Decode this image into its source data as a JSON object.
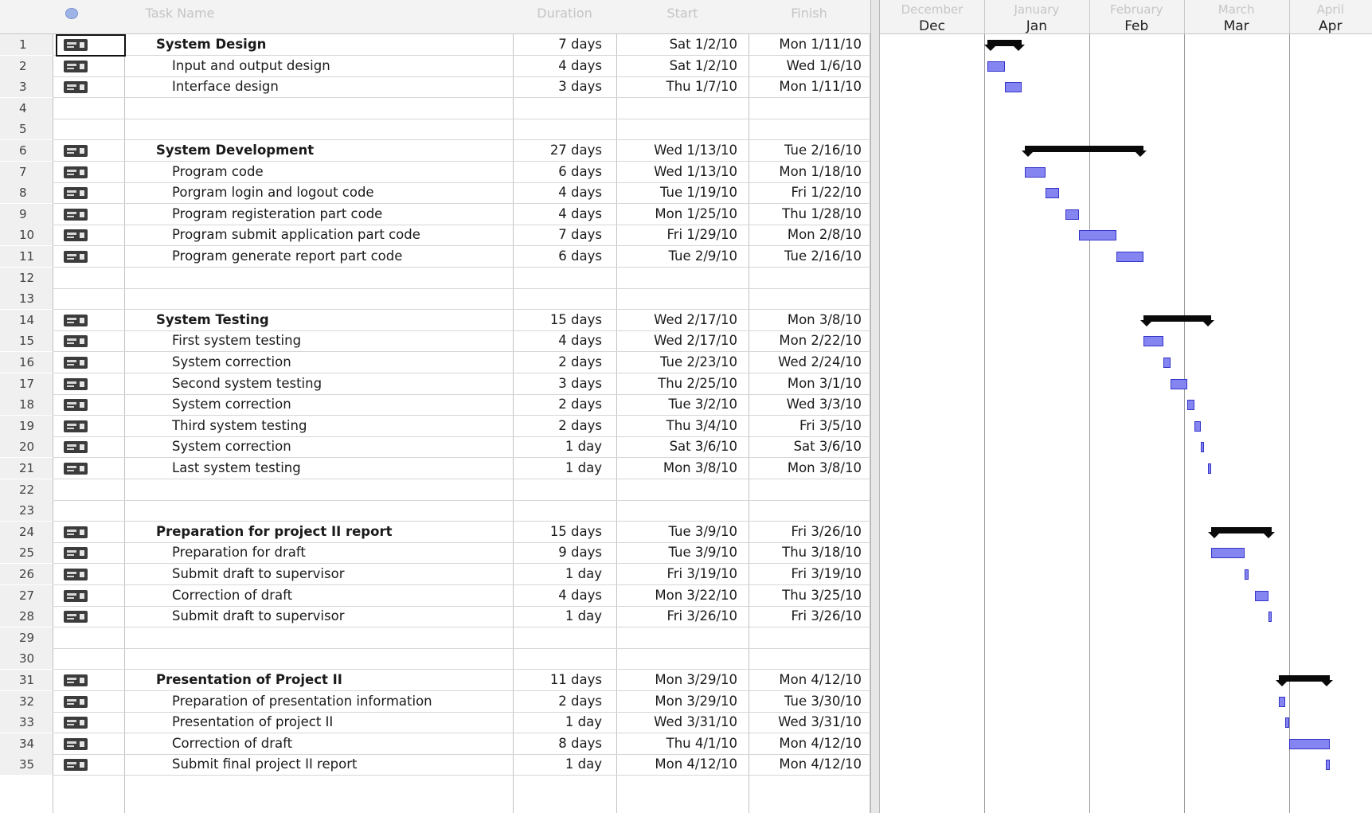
{
  "header": {
    "indicator_icon": "circle-info-icon",
    "columns": {
      "name": "Task Name",
      "duration": "Duration",
      "start": "Start",
      "finish": "Finish"
    },
    "timescale_top": [
      "December",
      "January",
      "February",
      "March",
      "April"
    ],
    "timescale_bottom": [
      "Dec",
      "Jan",
      "Feb",
      "Mar",
      "Apr"
    ]
  },
  "tasks": [
    {
      "id": "1",
      "name": "System Design",
      "duration": "7 days",
      "start": "Sat 1/2/10",
      "finish": "Mon 1/11/10",
      "summary": true
    },
    {
      "id": "2",
      "name": "Input and output design",
      "duration": "4 days",
      "start": "Sat 1/2/10",
      "finish": "Wed 1/6/10"
    },
    {
      "id": "3",
      "name": "Interface design",
      "duration": "3 days",
      "start": "Thu 1/7/10",
      "finish": "Mon 1/11/10"
    },
    {
      "id": "4"
    },
    {
      "id": "5"
    },
    {
      "id": "6",
      "name": "System Development",
      "duration": "27 days",
      "start": "Wed 1/13/10",
      "finish": "Tue 2/16/10",
      "summary": true
    },
    {
      "id": "7",
      "name": "Program code",
      "duration": "6 days",
      "start": "Wed 1/13/10",
      "finish": "Mon 1/18/10"
    },
    {
      "id": "8",
      "name": "Porgram login and logout code",
      "duration": "4 days",
      "start": "Tue 1/19/10",
      "finish": "Fri 1/22/10"
    },
    {
      "id": "9",
      "name": "Program registeration part code",
      "duration": "4 days",
      "start": "Mon 1/25/10",
      "finish": "Thu 1/28/10"
    },
    {
      "id": "10",
      "name": "Program submit application part code",
      "duration": "7 days",
      "start": "Fri 1/29/10",
      "finish": "Mon 2/8/10"
    },
    {
      "id": "11",
      "name": "Program generate report part code",
      "duration": "6 days",
      "start": "Tue 2/9/10",
      "finish": "Tue 2/16/10"
    },
    {
      "id": "12"
    },
    {
      "id": "13"
    },
    {
      "id": "14",
      "name": "System Testing",
      "duration": "15 days",
      "start": "Wed 2/17/10",
      "finish": "Mon 3/8/10",
      "summary": true
    },
    {
      "id": "15",
      "name": "First system testing",
      "duration": "4 days",
      "start": "Wed 2/17/10",
      "finish": "Mon 2/22/10"
    },
    {
      "id": "16",
      "name": "System correction",
      "duration": "2 days",
      "start": "Tue 2/23/10",
      "finish": "Wed 2/24/10"
    },
    {
      "id": "17",
      "name": "Second system testing",
      "duration": "3 days",
      "start": "Thu 2/25/10",
      "finish": "Mon 3/1/10"
    },
    {
      "id": "18",
      "name": "System correction",
      "duration": "2 days",
      "start": "Tue 3/2/10",
      "finish": "Wed 3/3/10"
    },
    {
      "id": "19",
      "name": "Third system testing",
      "duration": "2 days",
      "start": "Thu 3/4/10",
      "finish": "Fri 3/5/10"
    },
    {
      "id": "20",
      "name": "System correction",
      "duration": "1 day",
      "start": "Sat 3/6/10",
      "finish": "Sat 3/6/10"
    },
    {
      "id": "21",
      "name": "Last system testing",
      "duration": "1 day",
      "start": "Mon 3/8/10",
      "finish": "Mon 3/8/10"
    },
    {
      "id": "22"
    },
    {
      "id": "23"
    },
    {
      "id": "24",
      "name": "Preparation for project II report",
      "duration": "15 days",
      "start": "Tue 3/9/10",
      "finish": "Fri 3/26/10",
      "summary": true
    },
    {
      "id": "25",
      "name": "Preparation for draft",
      "duration": "9 days",
      "start": "Tue 3/9/10",
      "finish": "Thu 3/18/10"
    },
    {
      "id": "26",
      "name": "Submit draft to supervisor",
      "duration": "1 day",
      "start": "Fri 3/19/10",
      "finish": "Fri 3/19/10"
    },
    {
      "id": "27",
      "name": "Correction of draft",
      "duration": "4 days",
      "start": "Mon 3/22/10",
      "finish": "Thu 3/25/10"
    },
    {
      "id": "28",
      "name": "Submit draft to supervisor",
      "duration": "1 day",
      "start": "Fri 3/26/10",
      "finish": "Fri 3/26/10"
    },
    {
      "id": "29"
    },
    {
      "id": "30"
    },
    {
      "id": "31",
      "name": "Presentation of Project II",
      "duration": "11 days",
      "start": "Mon 3/29/10",
      "finish": "Mon 4/12/10",
      "summary": true
    },
    {
      "id": "32",
      "name": "Preparation of presentation information",
      "duration": "2 days",
      "start": "Mon 3/29/10",
      "finish": "Tue 3/30/10"
    },
    {
      "id": "33",
      "name": "Presentation of project II",
      "duration": "1 day",
      "start": "Wed 3/31/10",
      "finish": "Wed 3/31/10"
    },
    {
      "id": "34",
      "name": "Correction of draft",
      "duration": "8 days",
      "start": "Thu 4/1/10",
      "finish": "Mon 4/12/10"
    },
    {
      "id": "35",
      "name": "Submit final project II report",
      "duration": "1 day",
      "start": "Mon 4/12/10",
      "finish": "Mon 4/12/10"
    }
  ],
  "colors": {
    "task_bar": "#8585f2",
    "task_bar_border": "#3434c8",
    "summary_bar": "#0a0a0a",
    "grid_line": "#d6d6d6"
  }
}
